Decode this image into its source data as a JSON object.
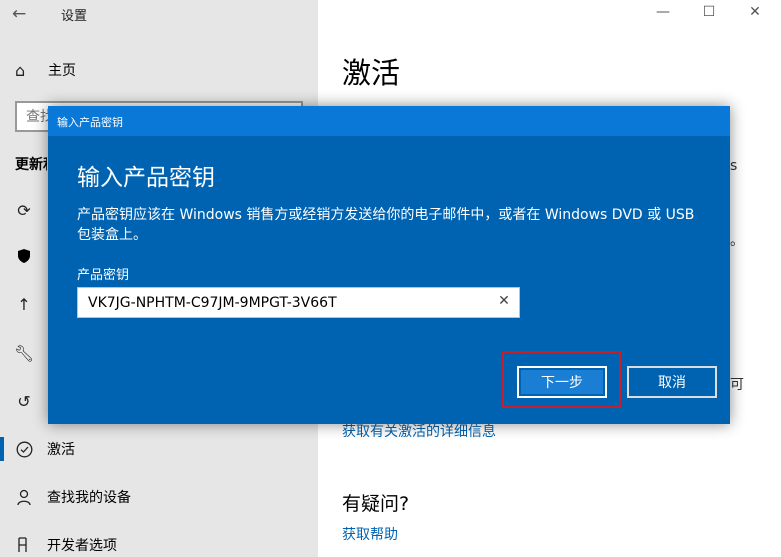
{
  "window": {
    "title": "设置",
    "back_icon": "back-arrow-icon",
    "minimize_glyph": "—",
    "maximize_glyph": "☐",
    "close_glyph": "✕"
  },
  "sidebar": {
    "home_label": "主页",
    "search_placeholder": "查找设置",
    "section_title": "更新和安全",
    "nav_items": [
      {
        "icon": "sync-icon",
        "label": ""
      },
      {
        "icon": "shield-icon",
        "label": ""
      },
      {
        "icon": "upload-icon",
        "label": ""
      },
      {
        "icon": "wrench-icon",
        "label": ""
      },
      {
        "icon": "history-icon",
        "label": ""
      },
      {
        "icon": "check-circle-icon",
        "label": "激活"
      },
      {
        "icon": "person-locate-icon",
        "label": "查找我的设备"
      },
      {
        "icon": "developer-icon",
        "label": "开发者选项"
      }
    ]
  },
  "content": {
    "title": "激活",
    "activation_info_link": "获取有关激活的详细信息",
    "question_title": "有疑问?",
    "help_link": "获取帮助",
    "edge_fragment_1": "s",
    "edge_fragment_2": "。",
    "edge_fragment_3": "可"
  },
  "dialog": {
    "title": "输入产品密钥",
    "heading": "输入产品密钥",
    "description": "产品密钥应该在 Windows 销售方或经销方发送给你的电子邮件中，或者在 Windows DVD 或 USB 包装盒上。",
    "key_label": "产品密钥",
    "key_value": "VK7JG-NPHTM-C97JM-9MPGT-3V66T",
    "clear_glyph": "✕",
    "next_label": "下一步",
    "cancel_label": "取消"
  },
  "colors": {
    "dialog_bg": "#0063b1",
    "titlebar_bg": "#0a78d7",
    "highlight": "#c81e2a",
    "link": "#0063b1"
  }
}
